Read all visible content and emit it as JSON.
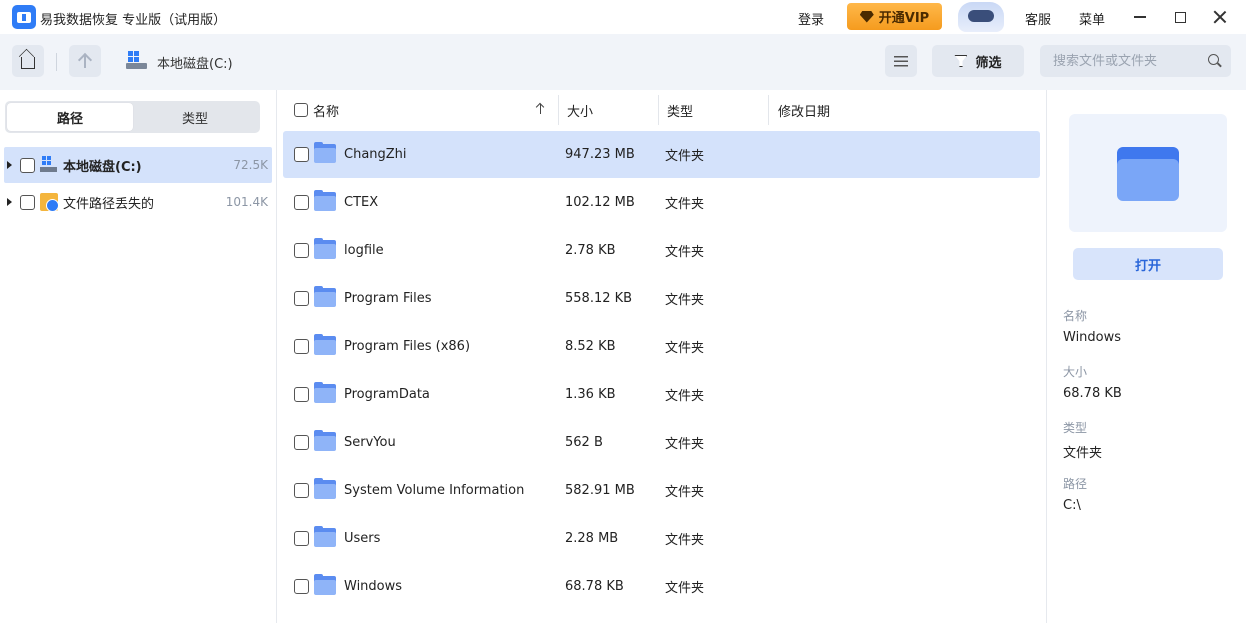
{
  "titlebar": {
    "app_title": "易我数据恢复 专业版（试用版）",
    "login": "登录",
    "vip": "开通VIP",
    "service": "客服",
    "menu": "菜单"
  },
  "toolbar": {
    "path": "本地磁盘(C:)",
    "filter": "筛选",
    "search_placeholder": "搜索文件或文件夹"
  },
  "left": {
    "tabs": [
      "路径",
      "类型"
    ],
    "tree": [
      {
        "label": "本地磁盘(C:)",
        "count": "72.5K"
      },
      {
        "label": "文件路径丢失的",
        "count": "101.4K"
      }
    ]
  },
  "table": {
    "headers": {
      "name": "名称",
      "size": "大小",
      "type": "类型",
      "date": "修改日期"
    },
    "rows": [
      {
        "name": "ChangZhi",
        "size": "947.23 MB",
        "type": "文件夹"
      },
      {
        "name": "CTEX",
        "size": "102.12 MB",
        "type": "文件夹"
      },
      {
        "name": "logfile",
        "size": "2.78 KB",
        "type": "文件夹"
      },
      {
        "name": "Program Files",
        "size": "558.12 KB",
        "type": "文件夹"
      },
      {
        "name": "Program Files (x86)",
        "size": "8.52 KB",
        "type": "文件夹"
      },
      {
        "name": "ProgramData",
        "size": "1.36 KB",
        "type": "文件夹"
      },
      {
        "name": "ServYou",
        "size": "562 B",
        "type": "文件夹"
      },
      {
        "name": "System Volume Information",
        "size": "582.91 MB",
        "type": "文件夹"
      },
      {
        "name": "Users",
        "size": "2.28 MB",
        "type": "文件夹"
      },
      {
        "name": "Windows",
        "size": "68.78 KB",
        "type": "文件夹"
      }
    ]
  },
  "details": {
    "open": "打开",
    "name_label": "名称",
    "name_value": "Windows",
    "size_label": "大小",
    "size_value": "68.78 KB",
    "type_label": "类型",
    "type_value": "文件夹",
    "path_label": "路径",
    "path_value": "C:\\"
  },
  "colors": {
    "accent": "#2f7cf6",
    "selection": "#d4e2fb",
    "vip": "#f59b1e"
  }
}
